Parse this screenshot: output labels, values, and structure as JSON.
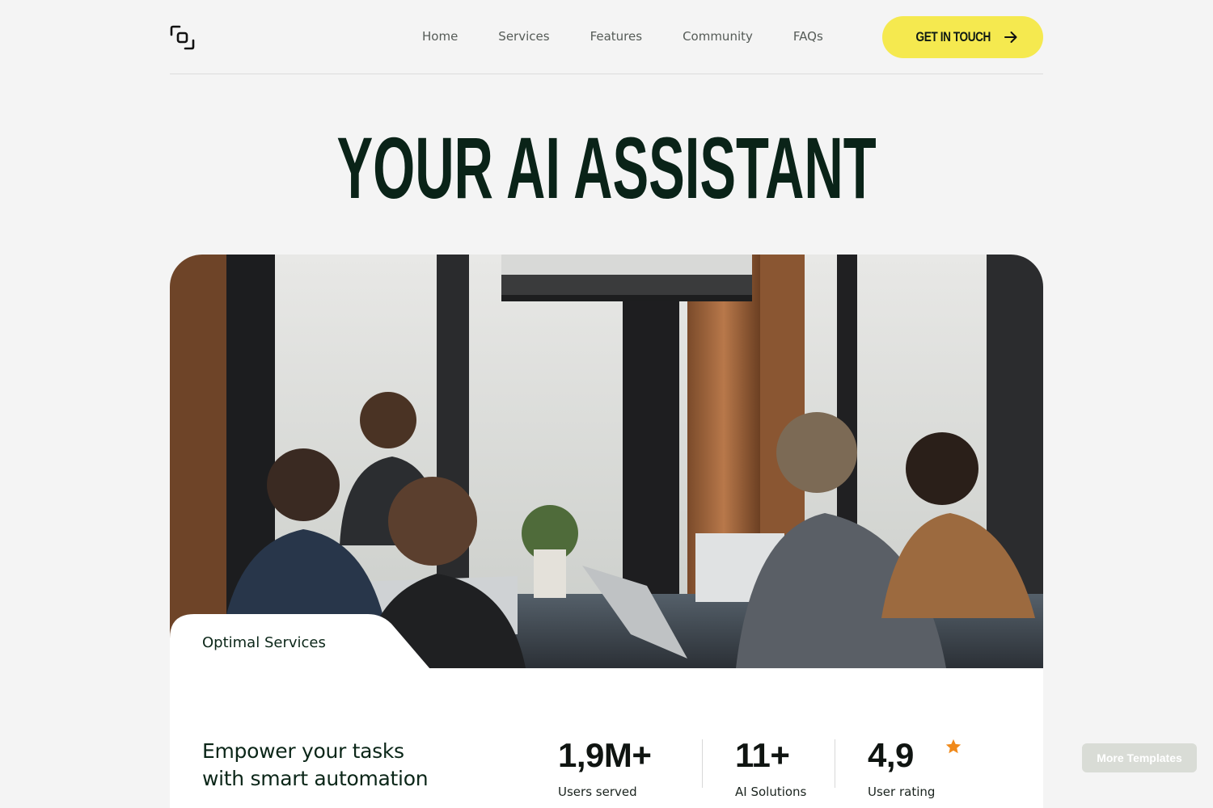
{
  "nav": {
    "logo_icon": "chain-link-icon",
    "links": [
      "Home",
      "Services",
      "Features",
      "Community",
      "FAQs"
    ],
    "cta_label": "GET IN TOUCH",
    "cta_icon": "arrow-right-icon",
    "cta_color": "#f5e94f"
  },
  "hero": {
    "title": "YOUR AI ASSISTANT",
    "image_icon": "team-meeting-photo"
  },
  "card": {
    "tab_label": "Optimal Services",
    "tagline_line1": "Empower your tasks",
    "tagline_line2": "with smart automation",
    "stats": [
      {
        "value": "1,9M+",
        "label": "Users served"
      },
      {
        "value": "11+",
        "label": "AI Solutions"
      },
      {
        "value": "4,9",
        "label": "User rating"
      }
    ],
    "rating_icon": "star-icon",
    "star_color": "#f08a1c"
  },
  "more_templates_label": "More Templates",
  "colors": {
    "background": "#f4f4f4",
    "text_dark": "#0b2618",
    "accent_yellow": "#f5e94f"
  }
}
